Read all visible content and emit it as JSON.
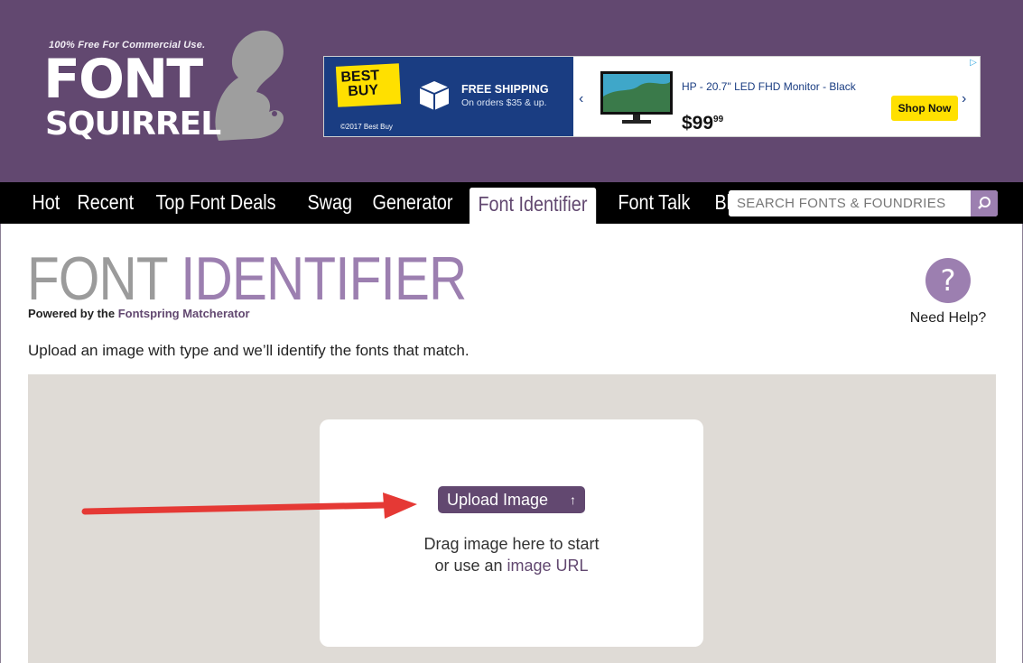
{
  "logo": {
    "tagline": "100% Free For Commercial Use.",
    "word1": "FONT",
    "word2": "SQUIRREL"
  },
  "ad": {
    "brand_line1": "BEST",
    "brand_line2": "BUY",
    "copyright": "©2017 Best Buy",
    "shipping_title": "FREE SHIPPING",
    "shipping_sub": "On orders $35 & up.",
    "product_name": "HP - 20.7\" LED FHD Monitor - Black",
    "price_dollars": "$99",
    "price_cents": "99",
    "cta": "Shop Now",
    "prev_icon": "‹",
    "next_icon": "›",
    "adchoices_icon": "▷"
  },
  "nav": {
    "items": [
      {
        "label": "Hot"
      },
      {
        "label": "Recent"
      },
      {
        "label": "Top Font Deals"
      },
      {
        "label": "Swag"
      },
      {
        "label": "Generator"
      },
      {
        "label": "Font Identifier",
        "active": true
      },
      {
        "label": "Font Talk"
      },
      {
        "label": "Blog"
      }
    ],
    "search_placeholder": "SEARCH FONTS & FOUNDRIES"
  },
  "page": {
    "title_part1": "FONT",
    "title_part2": "IDENTIFIER",
    "powered_prefix": "Powered by the",
    "powered_link": "Fontspring Matcherator",
    "help_symbol": "?",
    "help_label": "Need Help?",
    "intro": "Upload an image with type and we’ll identify the fonts that match."
  },
  "upload": {
    "button_label": "Upload Image",
    "button_icon": "↑",
    "drag_line1": "Drag image here to start",
    "drag_line2_prefix": "or use an",
    "drag_line2_link": "image URL"
  },
  "colors": {
    "brand_purple": "#624870",
    "accent_lavender": "#9c7fb0",
    "dropzone_bg": "#dfdbd6",
    "annotation_red": "#e53935"
  }
}
